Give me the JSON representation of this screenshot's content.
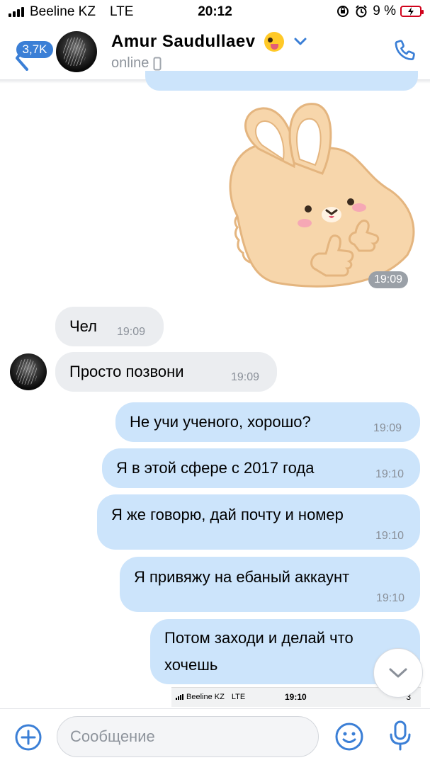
{
  "status_bar": {
    "carrier": "Beeline KZ",
    "network": "LTE",
    "time": "20:12",
    "battery_percent": "9 %",
    "battery_level": 0.09,
    "battery_color": "#d0021b"
  },
  "header": {
    "back_badge": "3,7K",
    "contact_name": "Amur Saudullaev",
    "status": "online",
    "accent_color": "#3b7fd6"
  },
  "messages": [
    {
      "type": "sticker",
      "direction": "out",
      "sticker_icon": "bunny-thumbs-up-sticker",
      "time": "19:09"
    },
    {
      "type": "text",
      "direction": "in",
      "text": "Чел",
      "time": "19:09"
    },
    {
      "type": "text",
      "direction": "in",
      "text": "Просто позвони",
      "time": "19:09"
    },
    {
      "type": "text",
      "direction": "out",
      "text": "Не учи ученого, хорошо?",
      "time": "19:09"
    },
    {
      "type": "text",
      "direction": "out",
      "text": "Я в этой сфере с 2017 года",
      "time": "19:10"
    },
    {
      "type": "text",
      "direction": "out",
      "text": "Я же говорю, дай почту и номер",
      "time": "19:10"
    },
    {
      "type": "text",
      "direction": "out",
      "text": "Я привяжу на ебаный аккаунт",
      "time": "19:10"
    },
    {
      "type": "text",
      "direction": "out",
      "text": "Потом заходи и делай что хочешь",
      "text_line1": "Потом заходи и делай что",
      "text_line2": "хочешь"
    }
  ],
  "nested_screenshot": {
    "carrier": "Beeline KZ",
    "network": "LTE",
    "time": "19:10",
    "right": "3"
  },
  "composer": {
    "placeholder": "Сообщение"
  },
  "colors": {
    "outgoing_bubble": "#cce4fb",
    "incoming_bubble": "#ebedf0",
    "icon_blue": "#3b7fd6"
  }
}
